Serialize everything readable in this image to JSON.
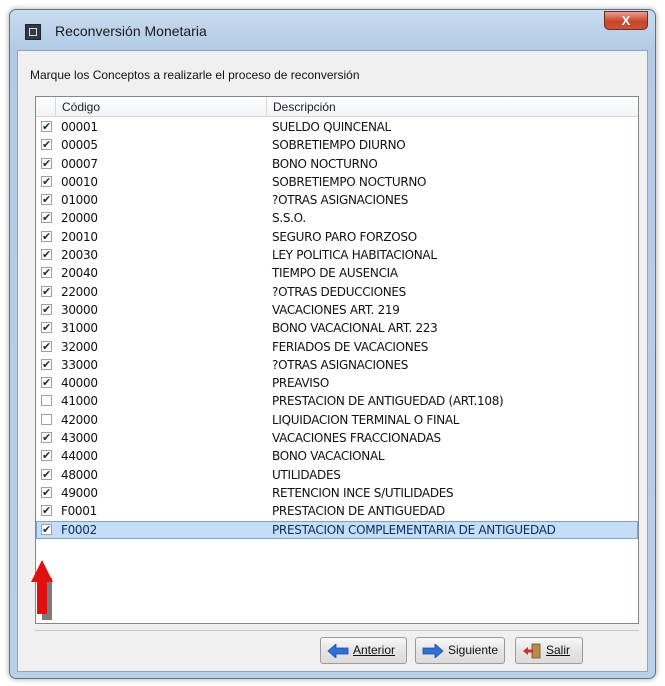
{
  "window": {
    "title": "Reconversión Monetaria",
    "close_glyph": "X"
  },
  "instruction": "Marque los Conceptos  a realizarle el proceso de reconversión",
  "table": {
    "headers": {
      "code": "Código",
      "description": "Descripción"
    },
    "rows": [
      {
        "code": "00001",
        "description": "SUELDO QUINCENAL",
        "checked": true
      },
      {
        "code": "00005",
        "description": "SOBRETIEMPO DIURNO",
        "checked": true
      },
      {
        "code": "00007",
        "description": "BONO NOCTURNO",
        "checked": true
      },
      {
        "code": "00010",
        "description": "SOBRETIEMPO NOCTURNO",
        "checked": true
      },
      {
        "code": "01000",
        "description": "?OTRAS ASIGNACIONES",
        "checked": true
      },
      {
        "code": "20000",
        "description": "S.S.O.",
        "checked": true
      },
      {
        "code": "20010",
        "description": "SEGURO PARO FORZOSO",
        "checked": true
      },
      {
        "code": "20030",
        "description": "LEY POLITICA HABITACIONAL",
        "checked": true
      },
      {
        "code": "20040",
        "description": "TIEMPO DE AUSENCIA",
        "checked": true
      },
      {
        "code": "22000",
        "description": "?OTRAS DEDUCCIONES",
        "checked": true
      },
      {
        "code": "30000",
        "description": "VACACIONES ART. 219",
        "checked": true
      },
      {
        "code": "31000",
        "description": "BONO VACACIONAL ART. 223",
        "checked": true
      },
      {
        "code": "32000",
        "description": "FERIADOS DE VACACIONES",
        "checked": true
      },
      {
        "code": "33000",
        "description": "?OTRAS ASIGNACIONES",
        "checked": true
      },
      {
        "code": "40000",
        "description": "PREAVISO",
        "checked": true
      },
      {
        "code": "41000",
        "description": "PRESTACION DE ANTIGUEDAD (ART.108)",
        "checked": false
      },
      {
        "code": "42000",
        "description": "LIQUIDACION TERMINAL O FINAL",
        "checked": false
      },
      {
        "code": "43000",
        "description": "VACACIONES FRACCIONADAS",
        "checked": true
      },
      {
        "code": "44000",
        "description": "BONO VACACIONAL",
        "checked": true
      },
      {
        "code": "48000",
        "description": "UTILIDADES",
        "checked": true
      },
      {
        "code": "49000",
        "description": "RETENCION INCE S/UTILIDADES",
        "checked": true
      },
      {
        "code": "F0001",
        "description": "PRESTACION DE ANTIGUEDAD",
        "checked": true
      },
      {
        "code": "F0002",
        "description": "PRESTACION COMPLEMENTARIA DE ANTIGUEDAD",
        "checked": true,
        "selected": true
      }
    ]
  },
  "buttons": {
    "previous": "Anterior",
    "next": "Siguiente",
    "exit": "Salir"
  },
  "icons": {
    "previous": "left-arrow-icon",
    "next": "right-arrow-icon",
    "exit": "exit-door-icon",
    "annotation": "red-up-arrow-icon"
  },
  "colors": {
    "arrow_blue": "#2f6fd6",
    "annotation_red": "#e01010",
    "selection": "#c5ddf6"
  }
}
